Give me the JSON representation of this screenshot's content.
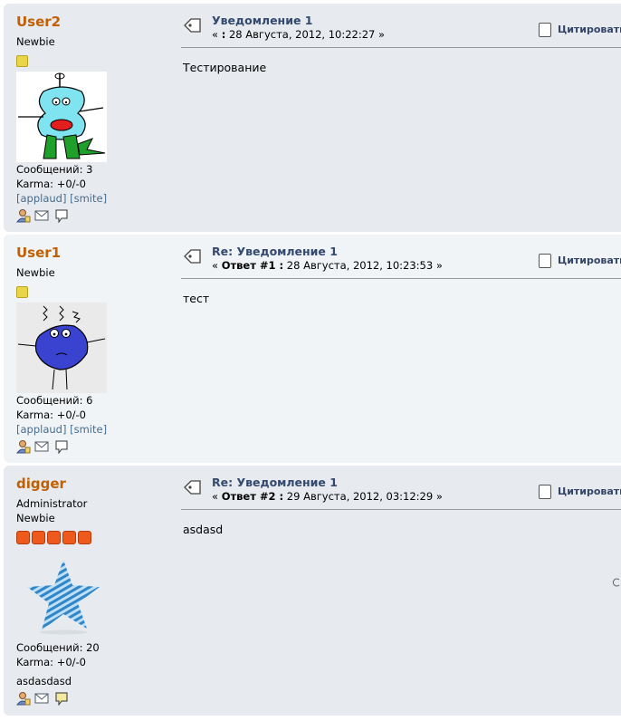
{
  "posts": [
    {
      "username": "User2",
      "titles": [
        "Newbie"
      ],
      "posts_label": "Сообщений: 3",
      "karma": "Karma: +0/-0",
      "applaud": "[applaud]",
      "smite": "[smite]",
      "subject": "Уведомление 1",
      "date_prefix": "« ",
      "date_bold": ":",
      "date_text": " 28 Августа, 2012, 10:22:27 »",
      "body": "Тестирование",
      "quote_label": "Цитировать",
      "star_color": "#e9d548"
    },
    {
      "username": "User1",
      "titles": [
        "Newbie"
      ],
      "posts_label": "Сообщений: 6",
      "karma": "Karma: +0/-0",
      "applaud": "[applaud]",
      "smite": "[smite]",
      "subject": "Re: Уведомление 1",
      "date_prefix": "« ",
      "date_bold": "Ответ #1 :",
      "date_text": " 28 Августа, 2012, 10:23:53 »",
      "body": "тест",
      "quote_label": "Цитировать",
      "star_color": "#e9d548"
    },
    {
      "username": "digger",
      "titles": [
        "Administrator",
        "Newbie"
      ],
      "posts_label": "Сообщений: 20",
      "karma": "Karma: +0/-0",
      "signature_text": "asdasdasd",
      "subject": "Re: Уведомление 1",
      "date_prefix": "« ",
      "date_bold": "Ответ #2 :",
      "date_text": " 29 Августа, 2012, 03:12:29 »",
      "body": "asdasd",
      "quote_label": "Цитировать",
      "star_color": "#ee5a1c"
    }
  ],
  "icons": {
    "profile": "profile-icon",
    "email": "email-icon",
    "pm": "personal-message-icon",
    "subject": "post-subject-icon",
    "quote": "quote-icon"
  }
}
